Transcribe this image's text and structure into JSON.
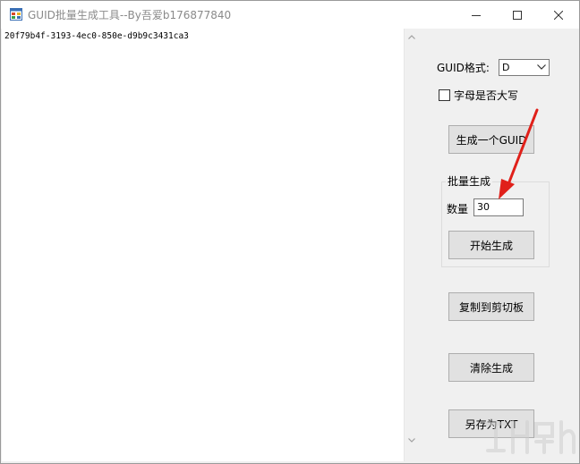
{
  "window": {
    "title": "GUID批量生成工具--By吾爱b176877840"
  },
  "output": {
    "text": "20f79b4f-3193-4ec0-850e-d9b9c3431ca3"
  },
  "panel": {
    "format_label": "GUID格式:",
    "format_value": "D",
    "uppercase_label": "字母是否大写",
    "uppercase_checked": false,
    "generate_one_label": "生成一个GUID",
    "batch_group_label": "批量生成",
    "quantity_label": "数量",
    "quantity_value": "30",
    "start_label": "开始生成",
    "copy_label": "复制到剪切板",
    "clear_label": "清除生成",
    "save_label": "另存为TXT"
  },
  "icons": {
    "app": "app-window-icon",
    "minimize": "minimize-icon",
    "maximize": "maximize-icon",
    "close": "close-icon",
    "dropdown": "chevron-down-icon",
    "scroll_up": "scroll-up-icon",
    "scroll_down": "scroll-down-icon"
  },
  "colors": {
    "annotation_arrow": "#e0201a"
  }
}
